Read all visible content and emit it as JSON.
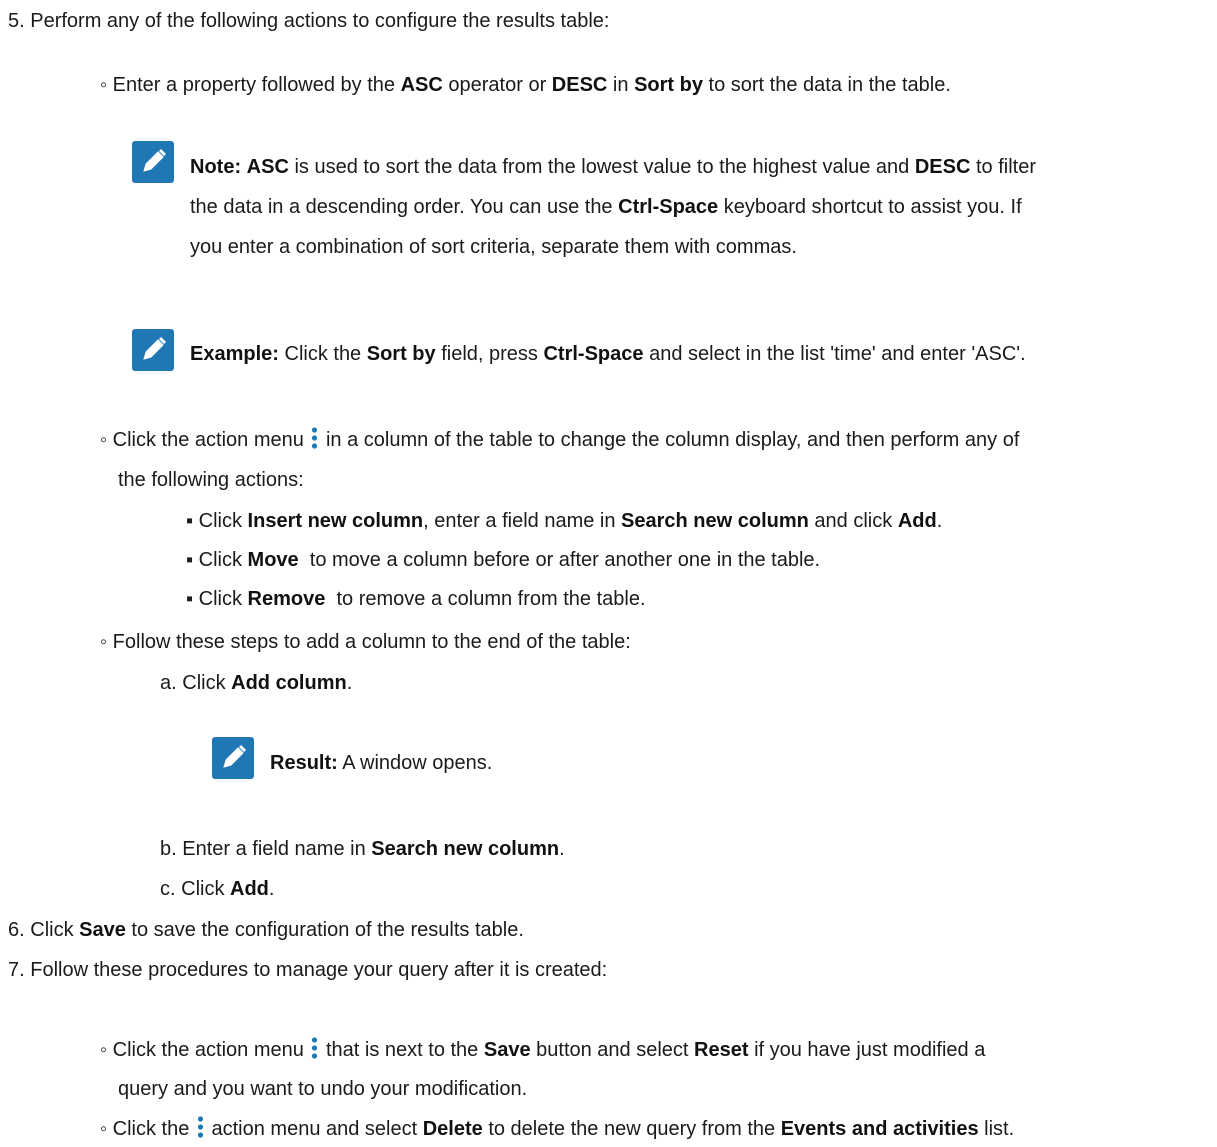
{
  "colors": {
    "note_icon_bg": "#1f78b4",
    "kebab_color": "#1f78b4",
    "text": "#1b1b1b"
  },
  "icons": {
    "note": "pencil-note-icon",
    "action_menu": "vertical-kebab-icon"
  },
  "step5": {
    "number": "5.",
    "text": "Perform any of the following actions to configure the results table:",
    "sort": {
      "bullet": "◦",
      "t1": "Enter a property followed by the ",
      "asc": "ASC",
      "t2": " operator or ",
      "desc": "DESC",
      "t3": " in ",
      "sort_by": "Sort by",
      "t4": " to sort the data in the table."
    },
    "note": {
      "label": "Note:",
      "l1_asc": "ASC",
      "l1_t1": " is used to sort the data from the lowest value to the highest value and ",
      "l1_desc": "DESC",
      "l1_t2": " to filter",
      "l2_t1": "the data in a descending order. You can use the ",
      "l2_ctrl": "Ctrl-Space",
      "l2_t2": " keyboard shortcut to assist you. If",
      "l3": "you enter a combination of sort criteria, separate them with commas."
    },
    "example": {
      "label": "Example:",
      "t1": " Click the ",
      "sort_by": "Sort by",
      "t2": " field, press ",
      "ctrl": "Ctrl-Space",
      "t3": " and select in the list 'time' and enter 'ASC'."
    },
    "action_menu": {
      "bullet": "◦",
      "t1": "Click the action menu",
      "t2": "in a column of the table to change the column display, and then perform any of",
      "t3": "the following actions:",
      "items": [
        {
          "bullet": "▪",
          "t1": "Click ",
          "b1": "Insert new column",
          "t2": ", enter a field name in ",
          "b2": "Search new column",
          "t3": " and click ",
          "b3": "Add",
          "t4": "."
        },
        {
          "bullet": "▪",
          "t1": "Click ",
          "b1": "Move",
          "t2": "  to move a column before or after another one in the table."
        },
        {
          "bullet": "▪",
          "t1": "Click ",
          "b1": "Remove",
          "t2": "  to remove a column from the table."
        }
      ]
    },
    "add_column": {
      "bullet": "◦",
      "text": "Follow these steps to add a column to the end of the table:",
      "a": {
        "marker": "a.",
        "t1": "Click ",
        "b1": "Add column",
        "t2": "."
      },
      "result": {
        "label": "Result:",
        "text": " A window opens."
      },
      "b": {
        "marker": "b.",
        "t1": "Enter a field name in ",
        "b1": "Search new column",
        "t2": "."
      },
      "c": {
        "marker": "c.",
        "t1": "Click ",
        "b1": "Add",
        "t2": "."
      }
    }
  },
  "step6": {
    "number": "6.",
    "t1": "Click ",
    "save": "Save",
    "t2": " to save the configuration of the results table."
  },
  "step7": {
    "number": "7.",
    "text": "Follow these procedures to manage your query after it is created:",
    "reset": {
      "bullet": "◦",
      "t1": "Click the action menu",
      "t2": "that is next to the ",
      "save": "Save",
      "t3": " button and select ",
      "reset": "Reset",
      "t4": " if you have just modified a",
      "t5": "query and you want to undo your modification."
    },
    "delete": {
      "bullet": "◦",
      "t1": "Click the",
      "t2": "action menu and select ",
      "delete": "Delete",
      "t3": " to delete the new query from the ",
      "list": "Events and activities",
      "t4": " list."
    }
  }
}
